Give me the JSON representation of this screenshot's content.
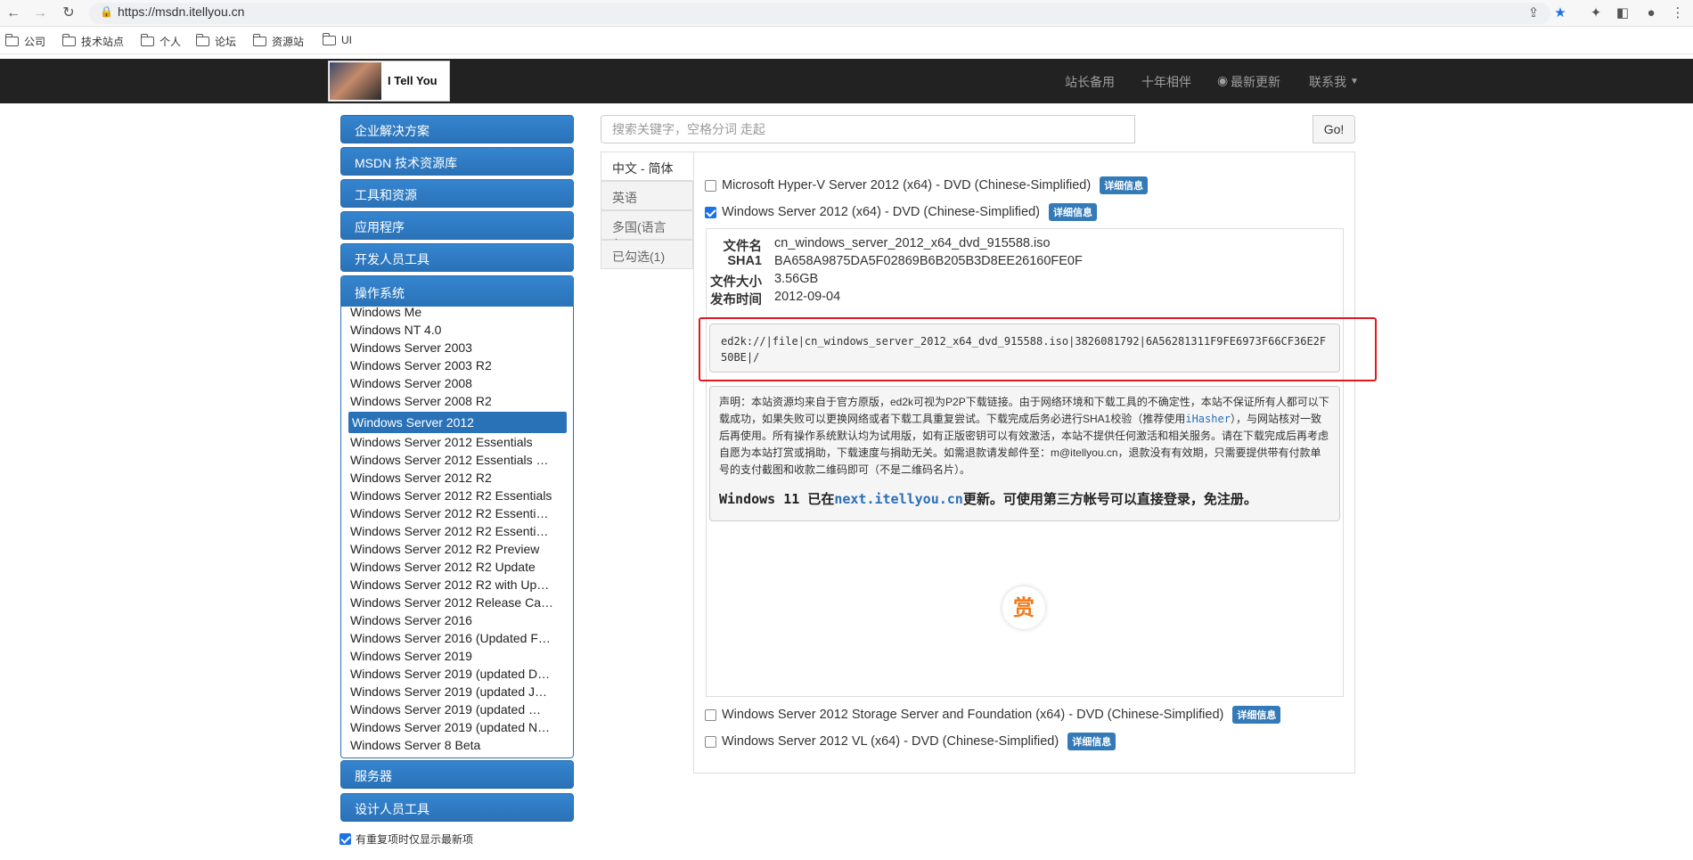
{
  "browser": {
    "url": "https://msdn.itellyou.cn",
    "bookmarks": [
      "公司",
      "技术站点",
      "个人",
      "论坛",
      "资源站",
      "UI"
    ]
  },
  "site": {
    "logo_text": "I Tell You",
    "nav": [
      "站长备用",
      "十年相伴",
      "最新更新",
      "联系我"
    ]
  },
  "sidebar": {
    "top_buttons": [
      "企业解决方案",
      "MSDN 技术资源库",
      "工具和资源",
      "应用程序",
      "开发人员工具"
    ],
    "os_title": "操作系统",
    "os_items": [
      "Windows Me",
      "Windows NT 4.0",
      "Windows Server 2003",
      "Windows Server 2003 R2",
      "Windows Server 2008",
      "Windows Server 2008 R2",
      "Windows Server 2012",
      "Windows Server 2012 Essentials",
      "Windows Server 2012 Essentials …",
      "Windows Server 2012 R2",
      "Windows Server 2012 R2 Essentials",
      "Windows Server 2012 R2 Essenti…",
      "Windows Server 2012 R2 Essenti…",
      "Windows Server 2012 R2 Preview",
      "Windows Server 2012 R2 Update",
      "Windows Server 2012 R2 with Up…",
      "Windows Server 2012 Release Ca…",
      "Windows Server 2016",
      "Windows Server 2016 (Updated F…",
      "Windows Server 2019",
      "Windows Server 2019 (updated D…",
      "Windows Server 2019 (updated J…",
      "Windows Server 2019 (updated …",
      "Windows Server 2019 (updated N…",
      "Windows Server 8 Beta"
    ],
    "active_index": 6,
    "bottom_buttons": [
      "服务器",
      "设计人员工具"
    ],
    "checkbox_label": "有重复项时仅显示最新项"
  },
  "search": {
    "placeholder": "搜索关键字，空格分词 走起",
    "button": "Go!"
  },
  "tabs": [
    "中文 - 简体",
    "英语",
    "多国(语言包)",
    "已勾选(1)"
  ],
  "items": [
    {
      "title": "Microsoft Hyper-V Server 2012 (x64) - DVD (Chinese-Simplified)",
      "badge": "详细信息",
      "checked": false
    },
    {
      "title": "Windows Server 2012 (x64) - DVD (Chinese-Simplified)",
      "badge": "详细信息",
      "checked": true
    },
    {
      "title": "Windows Server 2012 Storage Server and Foundation (x64) - DVD (Chinese-Simplified)",
      "badge": "详细信息",
      "checked": false
    },
    {
      "title": "Windows Server 2012 VL (x64) - DVD (Chinese-Simplified)",
      "badge": "详细信息",
      "checked": false
    }
  ],
  "detail": {
    "filename_label": "文件名",
    "filename": "cn_windows_server_2012_x64_dvd_915588.iso",
    "sha1_label": "SHA1",
    "sha1": "BA658A9875DA5F02869B6B205B3D8EE26160FE0F",
    "size_label": "文件大小",
    "size": "3.56GB",
    "date_label": "发布时间",
    "date": "2012-09-04",
    "ed2k": "ed2k://|file|cn_windows_server_2012_x64_dvd_915588.iso|3826081792|6A56281311F9FE6973F66CF36E2F50BE|/",
    "notice_part1": "声明：本站资源均来自于官方原版，ed2k可视为P2P下载链接。由于网络环境和下载工具的不确定性，本站不保证所有人都可以下载成功，如果失败可以更换网络或者下载工具重复尝试。下载完成后务必进行SHA1校验（推荐使用",
    "notice_link": "iHasher",
    "notice_part2": "），与网站核对一致后再使用。所有操作系统默认均为试用版，如有正版密钥可以有效激活，本站不提供任何激活和相关服务。请在下载完成后再考虑自愿为本站打赏或捐助，下载速度与捐助无关。如需退款请发邮件至：m@itellyou.cn，退款没有有效期，只需要提供带有付款单号的支付截图和收款二维码即可（不是二维码名片）。",
    "win11_prefix": "Windows 11 已在",
    "win11_link": "next.itellyou.cn",
    "win11_suffix": "更新。可使用第三方帐号可以直接登录，免注册。",
    "reward": "赏"
  }
}
